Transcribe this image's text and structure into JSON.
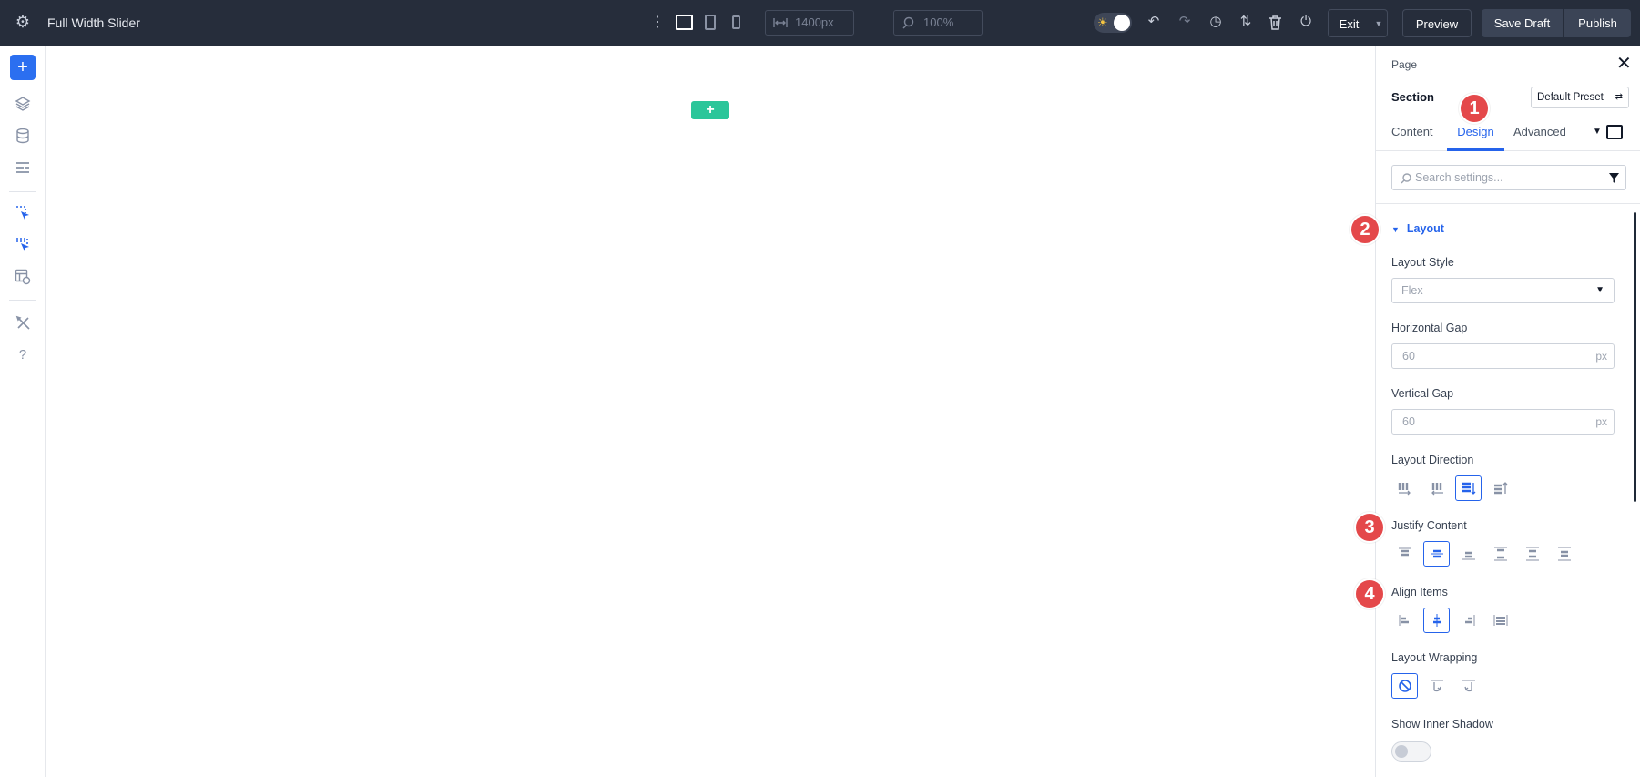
{
  "topbar": {
    "title": "Full Width Slider",
    "width_value": "1400px",
    "zoom_value": "100%",
    "exit_label": "Exit",
    "preview_label": "Preview",
    "save_draft_label": "Save Draft",
    "publish_label": "Publish"
  },
  "panel": {
    "breadcrumb": "Page",
    "element": "Section",
    "preset_label": "Default Preset",
    "tabs": [
      {
        "label": "Content"
      },
      {
        "label": "Design"
      },
      {
        "label": "Advanced"
      }
    ],
    "active_tab": "Design",
    "search_placeholder": "Search settings...",
    "group_title": "Layout",
    "fields": {
      "layout_style_label": "Layout Style",
      "layout_style_value": "Flex",
      "horizontal_gap_label": "Horizontal Gap",
      "horizontal_gap_value": "60",
      "vertical_gap_label": "Vertical Gap",
      "vertical_gap_value": "60",
      "gap_unit": "px",
      "layout_direction_label": "Layout Direction",
      "justify_content_label": "Justify Content",
      "align_items_label": "Align Items",
      "layout_wrapping_label": "Layout Wrapping",
      "inner_shadow_label": "Show Inner Shadow"
    }
  },
  "callouts": [
    "1",
    "2",
    "3",
    "4"
  ],
  "colors": {
    "accent": "#2563eb",
    "callout": "#e4484a",
    "topbar": "#262d3b",
    "canvas_add": "#2bc69a"
  }
}
